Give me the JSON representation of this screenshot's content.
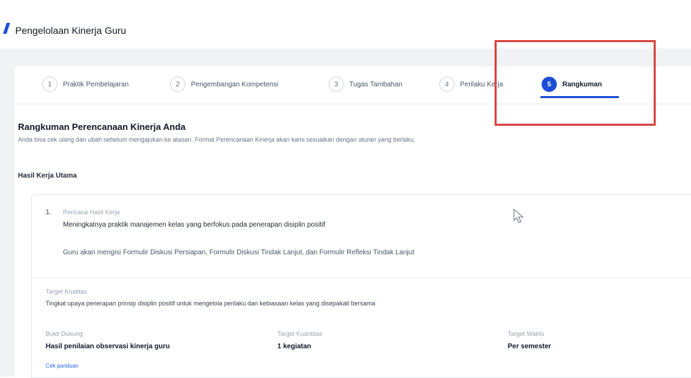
{
  "app": {
    "title": "Pengelolaan Kinerja Guru"
  },
  "tabs": [
    {
      "num": "1",
      "label": "Praktik Pembelajaran"
    },
    {
      "num": "2",
      "label": "Pengembangan Kompetensi"
    },
    {
      "num": "3",
      "label": "Tugas Tambahan"
    },
    {
      "num": "4",
      "label": "Perilaku Kerja"
    },
    {
      "num": "5",
      "label": "Rangkuman"
    }
  ],
  "summary": {
    "title": "Rangkuman Perencanaan Kinerja Anda",
    "description": "Anda bisa cek ulang dan ubah sebelum mengajukan ke atasan. Format Perencanaan Kinerja akan kami sesuaikan dengan aturan yang berlaku.",
    "section_title": "Hasil Kerja Utama"
  },
  "card": {
    "index": "1.",
    "rhk_label": "Rencana Hasil Kerja",
    "rhk_value": "Meningkatnya praktik manajemen kelas yang berfokus pada penerapan disiplin positif",
    "rhk_note": "Guru akan mengisi Formulir Diskusi Persiapan, Formulir Diskusi Tindak Lanjut, dan Formulir Refleksi Tindak Lanjut",
    "target_kualitas_label": "Target Kualitas",
    "target_kualitas_value": "Tingkat upaya penerapan prinsip disiplin positif untuk mengelola perilaku dan kebiasaan kelas yang disepakati bersama",
    "bukti_label": "Bukti Dukung",
    "bukti_value": "Hasil penilaian observasi kinerja guru",
    "kuantitas_label": "Target Kuantitas",
    "kuantitas_value": "1 kegiatan",
    "waktu_label": "Target Waktu",
    "waktu_value": "Per semester",
    "link_label": "Cek panduan"
  },
  "colors": {
    "accent": "#1d4ed8",
    "highlight": "#d64541"
  }
}
